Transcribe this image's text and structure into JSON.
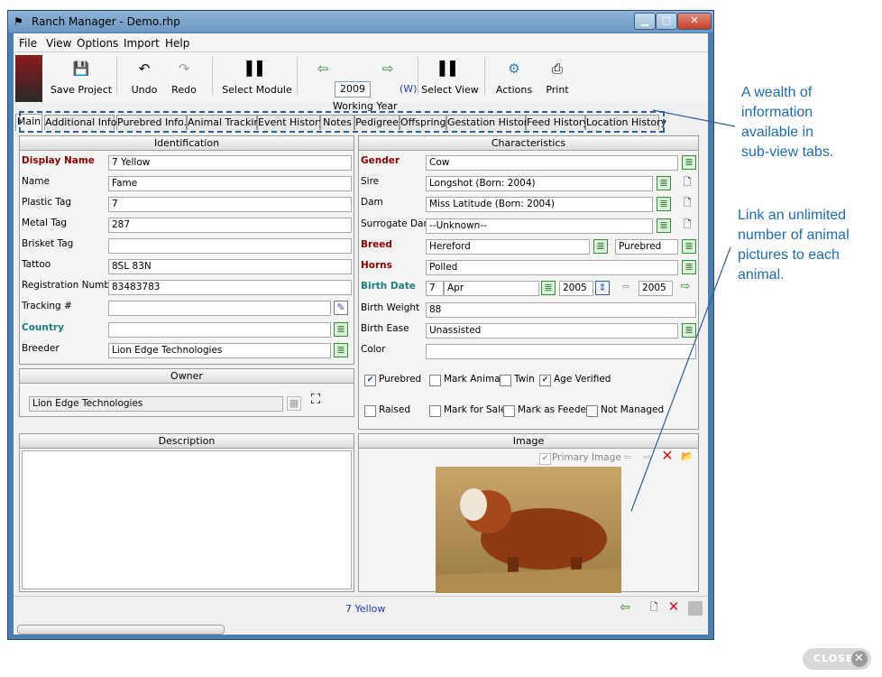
{
  "window": {
    "title": "Ranch Manager - Demo.rhp"
  },
  "menu": [
    "File",
    "View",
    "Options",
    "Import",
    "Help"
  ],
  "toolbar": {
    "save": "Save Project",
    "undo": "Undo",
    "redo": "Redo",
    "select_module": "Select Module",
    "year": "2009",
    "year_suffix": "(W)",
    "working_year": "Working Year",
    "select_view": "Select View",
    "actions": "Actions",
    "print": "Print"
  },
  "tabs": [
    "Main",
    "Additional Info.",
    "Purebred Info.",
    "Animal Tracking",
    "Event History",
    "Notes",
    "Pedigree",
    "Offspring",
    "Gestation History",
    "Feed History",
    "Location History"
  ],
  "identification": {
    "title": "Identification",
    "display_name_label": "Display Name",
    "display_name": "7 Yellow",
    "name_label": "Name",
    "name": "Fame",
    "plastic_label": "Plastic Tag",
    "plastic": "7",
    "metal_label": "Metal Tag",
    "metal": "287",
    "brisket_label": "Brisket Tag",
    "brisket": "",
    "tattoo_label": "Tattoo",
    "tattoo": "8SL 83N",
    "reg_label": "Registration Number",
    "reg": "83483783",
    "tracking_label": "Tracking #",
    "tracking": "",
    "country_label": "Country",
    "country": "",
    "breeder_label": "Breeder",
    "breeder": "Lion Edge Technologies"
  },
  "owner": {
    "title": "Owner",
    "value": "Lion Edge Technologies"
  },
  "description": {
    "title": "Description"
  },
  "characteristics": {
    "title": "Characteristics",
    "gender_label": "Gender",
    "gender": "Cow",
    "sire_label": "Sire",
    "sire": "Longshot (Born: 2004)",
    "dam_label": "Dam",
    "dam": "Miss Latitude (Born: 2004)",
    "surrogate_label": "Surrogate Dam",
    "surrogate": "--Unknown--",
    "breed_label": "Breed",
    "breed": "Hereford",
    "breed_type": "Purebred",
    "horns_label": "Horns",
    "horns": "Polled",
    "birthdate_label": "Birth Date",
    "birth_day": "7",
    "birth_month": "Apr",
    "birth_year": "2005",
    "birth_year2": "2005",
    "weight_label": "Birth Weight",
    "weight": "88",
    "ease_label": "Birth Ease",
    "ease": "Unassisted",
    "color_label": "Color",
    "color": ""
  },
  "flags": {
    "purebred": "Purebred",
    "mark_animal": "Mark Animal",
    "twin": "Twin",
    "age_verified": "Age Verified",
    "raised": "Raised",
    "mark_sale": "Mark for Sale",
    "mark_feeder": "Mark as Feeder",
    "not_managed": "Not Managed"
  },
  "image": {
    "title": "Image",
    "primary": "Primary Image"
  },
  "status": {
    "current": "7 Yellow"
  },
  "notes": {
    "tabs_note": [
      "A wealth of",
      "information",
      "available in",
      "sub-view tabs."
    ],
    "image_note": [
      "Link an unlimited",
      "number of animal",
      "pictures to each",
      "animal."
    ]
  },
  "close_label": "CLOSE",
  "colors": {
    "accent": "#1e6cb0",
    "bold_label": "#8b0000",
    "teal_label": "#1f7f7f"
  }
}
